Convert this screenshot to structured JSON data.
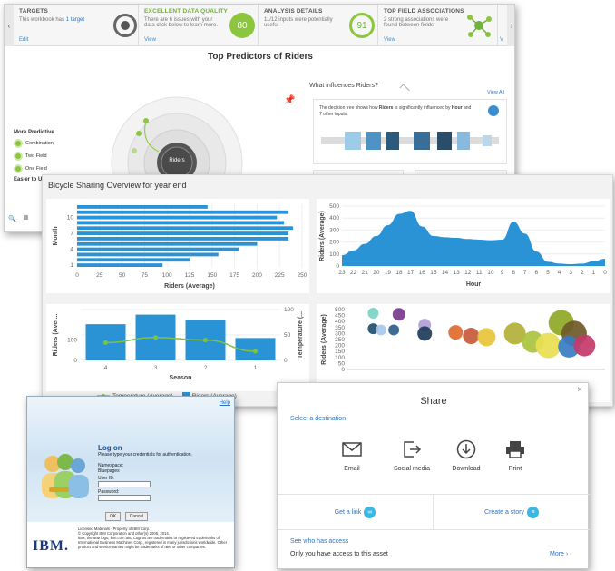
{
  "topbar": {
    "targets_title": "TARGETS",
    "targets_text": "This workbook has",
    "targets_count": "1 target",
    "targets_link": "Edit",
    "quality_title": "EXCELLENT DATA QUALITY",
    "quality_text": "There are 6 issues with your data click below to learn more.",
    "quality_link": "View",
    "quality_score": "80",
    "analysis_title": "ANALYSIS DETAILS",
    "analysis_text": "11/12 inputs were potentially useful",
    "analysis_score": "91",
    "assoc_title": "TOP FIELD ASSOCIATIONS",
    "assoc_text": "2 strong associations were found between fields",
    "assoc_link": "View",
    "next_link": "V"
  },
  "predictors": {
    "title_prefix": "Top Predictors of",
    "title_target": "Riders",
    "legend_head": "More Predictive",
    "legend_items": [
      "Combination",
      "Two Field",
      "One Field"
    ],
    "legend_foot": "Easier to U",
    "center_label": "Riders",
    "influence_title": "What influences Riders?",
    "view_all": "View All",
    "card_text_1": "The decision tree shows how",
    "card_target": "Riders",
    "card_text_2": "is significantly influenced by",
    "card_field": "Hour",
    "card_text_3": "and 7 other inputs."
  },
  "dashboard": {
    "title": "Bicycle Sharing Overview for year end",
    "legend_temp": "Temperature (Average)",
    "legend_riders": "Riders (Average)",
    "colors": {
      "bar": "#2a93d5",
      "line": "#7dc243"
    }
  },
  "chart_data": [
    {
      "type": "bar",
      "orientation": "horizontal",
      "categories": [
        "1",
        "2",
        "3",
        "4",
        "5",
        "6",
        "7",
        "8",
        "9",
        "10",
        "11",
        "12"
      ],
      "values": [
        95,
        125,
        157,
        180,
        200,
        235,
        235,
        240,
        230,
        222,
        235,
        145
      ],
      "ytick_labels": [
        "1",
        "4",
        "7",
        "10"
      ],
      "xticks": [
        0,
        25,
        50,
        75,
        100,
        125,
        150,
        175,
        200,
        225,
        250
      ],
      "xlabel": "Riders (Average)",
      "ylabel": "Month",
      "xlim": [
        0,
        250
      ]
    },
    {
      "type": "area",
      "x": [
        "23",
        "22",
        "21",
        "20",
        "19",
        "18",
        "17",
        "16",
        "15",
        "14",
        "13",
        "12",
        "11",
        "10",
        "9",
        "8",
        "7",
        "6",
        "5",
        "4",
        "3",
        "2",
        "1",
        "0"
      ],
      "values": [
        90,
        130,
        185,
        250,
        340,
        435,
        460,
        330,
        250,
        240,
        235,
        225,
        220,
        215,
        220,
        370,
        270,
        120,
        35,
        20,
        15,
        20,
        40,
        60
      ],
      "xlabel": "Hour",
      "ylabel": "Riders (Average)",
      "yticks": [
        0,
        100,
        200,
        300,
        400,
        500
      ],
      "ylim": [
        0,
        500
      ]
    },
    {
      "type": "bar",
      "categories": [
        "4",
        "3",
        "2",
        "1"
      ],
      "series": [
        {
          "name": "Riders (Average)",
          "values": [
            178,
            225,
            200,
            110
          ]
        },
        {
          "name": "Temperature (Average)",
          "values": [
            35,
            45,
            40,
            18
          ]
        }
      ],
      "xlabel": "Season",
      "ylabel": "Riders (Aver...",
      "y2label": "Temperature (...",
      "yticks": [
        0,
        100
      ],
      "y2ticks": [
        0,
        50,
        100
      ],
      "ylim": [
        0,
        250
      ],
      "y2lim": [
        0,
        100
      ]
    },
    {
      "type": "scatter",
      "ylabel": "Riders (Average)",
      "yticks": [
        0,
        50,
        100,
        150,
        200,
        250,
        300,
        350,
        400,
        450,
        500
      ],
      "ylim": [
        0,
        500
      ],
      "points": [
        {
          "x": 1,
          "y": 470,
          "r": 6,
          "color": "#7dd3c8"
        },
        {
          "x": 2,
          "y": 460,
          "r": 7,
          "color": "#7a3a8c"
        },
        {
          "x": 1,
          "y": 340,
          "r": 6,
          "color": "#1f4f6f"
        },
        {
          "x": 1.3,
          "y": 330,
          "r": 6,
          "color": "#a9c8e8"
        },
        {
          "x": 1.8,
          "y": 330,
          "r": 6,
          "color": "#2c5e8a"
        },
        {
          "x": 3,
          "y": 370,
          "r": 7,
          "color": "#b19ed6"
        },
        {
          "x": 3,
          "y": 300,
          "r": 8,
          "color": "#1e3b5a"
        },
        {
          "x": 4.2,
          "y": 310,
          "r": 8,
          "color": "#e06a2c"
        },
        {
          "x": 4.8,
          "y": 280,
          "r": 9,
          "color": "#c85a3c"
        },
        {
          "x": 5.4,
          "y": 270,
          "r": 10,
          "color": "#e6c43a"
        },
        {
          "x": 6.5,
          "y": 300,
          "r": 12,
          "color": "#b3b03a"
        },
        {
          "x": 7.2,
          "y": 230,
          "r": 12,
          "color": "#a9c33e"
        },
        {
          "x": 8.3,
          "y": 390,
          "r": 14,
          "color": "#8fa826"
        },
        {
          "x": 8.8,
          "y": 300,
          "r": 14,
          "color": "#6e5a28"
        },
        {
          "x": 7.8,
          "y": 200,
          "r": 14,
          "color": "#e8e050"
        },
        {
          "x": 8.6,
          "y": 190,
          "r": 12,
          "color": "#3a7cc2"
        },
        {
          "x": 9.2,
          "y": 200,
          "r": 12,
          "color": "#c43a6a"
        }
      ]
    }
  ],
  "logon": {
    "help": "Help",
    "title": "Log on",
    "subtitle": "Please type your credentials for authentication.",
    "namespace_label": "Namespace:",
    "namespace_value": "Bluepages",
    "userid_label": "User ID:",
    "password_label": "Password:",
    "ok_label": "OK",
    "cancel_label": "Cancel",
    "brand": "IBM.",
    "legal_1": "Licensed Materials - Property of IBM Corp.",
    "legal_2": "© Copyright IBM Corporation and other(s) 2005, 2014.",
    "legal_3": "IBM, the IBM logo, ibm.com and Cognos are trademarks or registered trademarks of International Business Machines Corp., registered in many jurisdictions worldwide. Other product and service names might be trademarks of IBM or other companies."
  },
  "share": {
    "title": "Share",
    "select_dest": "Select a destination",
    "options": [
      "Email",
      "Social media",
      "Download",
      "Print"
    ],
    "get_link": "Get a link",
    "create_story": "Create a story",
    "see_access": "See who has access",
    "access_text": "Only you have access to this asset",
    "more": "More",
    "close": "×"
  }
}
